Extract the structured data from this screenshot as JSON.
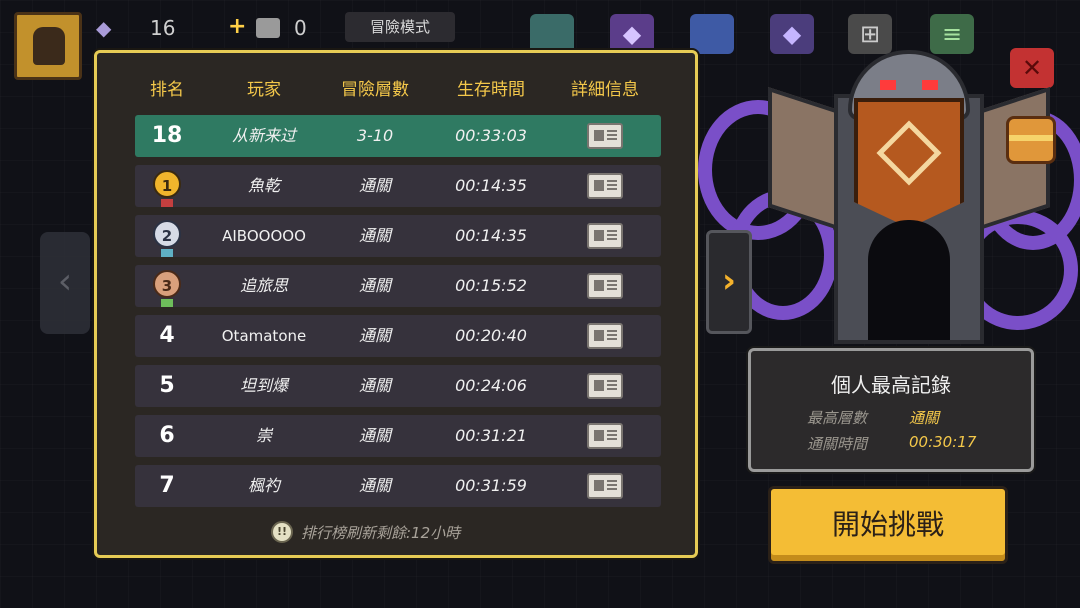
{
  "hud": {
    "gem_count": "16",
    "coin_count": "0",
    "mode_label": "冒險模式",
    "icons": [
      "avatar",
      "gem-icon",
      "coin-chest-icon",
      "shop-icon",
      "chest-icon",
      "gem-store-icon",
      "cart-icon",
      "menu-icon",
      "close-icon"
    ]
  },
  "leaderboard": {
    "headers": {
      "rank": "排名",
      "player": "玩家",
      "floor": "冒險層數",
      "time": "生存時間",
      "info": "詳細信息"
    },
    "my_row": {
      "rank": "18",
      "player": "从新来过",
      "floor": "3-10",
      "time": "00:33:03"
    },
    "rows": [
      {
        "rank": "1",
        "player": "魚乾",
        "floor": "通關",
        "time": "00:14:35"
      },
      {
        "rank": "2",
        "player": "AIBOOOOO",
        "floor": "通關",
        "time": "00:14:35"
      },
      {
        "rank": "3",
        "player": "追旅思",
        "floor": "通關",
        "time": "00:15:52"
      },
      {
        "rank": "4",
        "player": "Otamatone",
        "floor": "通關",
        "time": "00:20:40"
      },
      {
        "rank": "5",
        "player": "坦到爆",
        "floor": "通關",
        "time": "00:24:06"
      },
      {
        "rank": "6",
        "player": "崇",
        "floor": "通關",
        "time": "00:31:21"
      },
      {
        "rank": "7",
        "player": "楓礿",
        "floor": "通關",
        "time": "00:31:59"
      }
    ],
    "refresh_text": "排行榜刷新剩餘:12小時"
  },
  "personal_best": {
    "title": "個人最高記錄",
    "floor_label": "最高層數",
    "floor_value": "通關",
    "time_label": "通關時間",
    "time_value": "00:30:17"
  },
  "start_button": "開始挑戰",
  "colors": {
    "accent": "#f4c84a",
    "highlight_row": "#2f7a62",
    "button": "#f4bd35"
  }
}
